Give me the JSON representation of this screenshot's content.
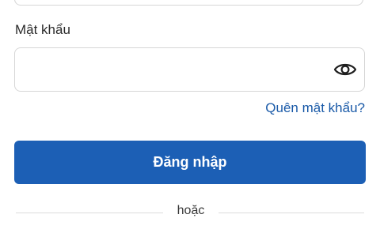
{
  "password": {
    "label": "Mật khẩu",
    "value": "",
    "placeholder": "",
    "toggle_icon": "eye-icon"
  },
  "forgot_password": {
    "label": "Quên mật khẩu?"
  },
  "login_button": {
    "label": "Đăng nhập"
  },
  "divider": {
    "label": "hoặc"
  },
  "colors": {
    "primary": "#1c5fb5",
    "link": "#1a5aa8",
    "border": "#d6d6d6",
    "text": "#2a2a2a"
  }
}
